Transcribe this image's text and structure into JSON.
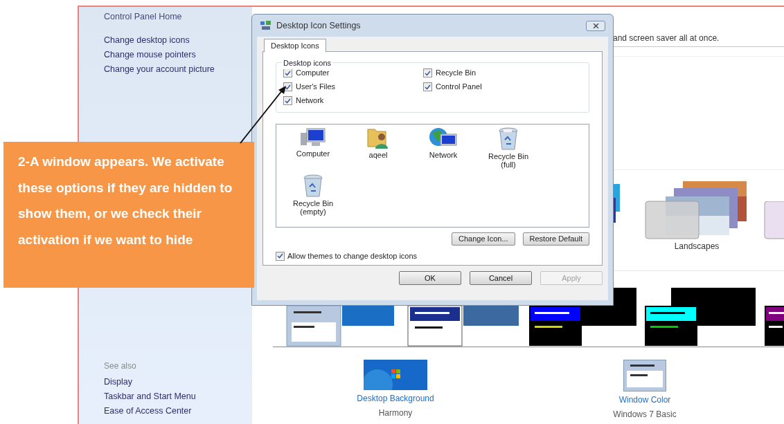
{
  "sidebar": {
    "home_link": "Control Panel Home",
    "tasks": [
      "Change desktop icons",
      "Change mouse pointers",
      "Change your account picture"
    ],
    "see_also_heading": "See also",
    "see_also": [
      "Display",
      "Taskbar and Start Menu",
      "Ease of Access Center"
    ]
  },
  "main": {
    "description": "and screen saver all at once.",
    "theme_label": "Landscapes",
    "bottom_items": [
      {
        "kind": "background",
        "label": "Desktop Background",
        "value": "Harmony"
      },
      {
        "kind": "window-color",
        "label": "Window Color",
        "value": "Windows 7 Basic"
      }
    ]
  },
  "dialog": {
    "title": "Desktop Icon Settings",
    "tabs": [
      {
        "label": "Desktop Icons",
        "selected": true
      }
    ],
    "group_label": "Desktop icons",
    "checkboxes": [
      {
        "label": "Computer",
        "checked": true
      },
      {
        "label": "User's Files",
        "checked": true
      },
      {
        "label": "Network",
        "checked": true
      },
      {
        "label": "Recycle Bin",
        "checked": true
      },
      {
        "label": "Control Panel",
        "checked": true
      }
    ],
    "icons": [
      {
        "kind": "computer",
        "label": "Computer"
      },
      {
        "kind": "user-folder",
        "label": "aqeel"
      },
      {
        "kind": "network",
        "label": "Network"
      },
      {
        "kind": "bin-full",
        "label": "Recycle Bin\n(full)"
      },
      {
        "kind": "bin-empty",
        "label": "Recycle Bin\n(empty)"
      }
    ],
    "icon_buttons": [
      "Change Icon...",
      "Restore Default"
    ],
    "allow_themes": {
      "label": "Allow themes to change desktop icons",
      "checked": true
    },
    "footer_buttons": [
      {
        "label": "OK",
        "disabled": false
      },
      {
        "label": "Cancel",
        "disabled": false
      },
      {
        "label": "Apply",
        "disabled": true
      }
    ]
  },
  "callout": {
    "text": "2-A window appears. We activate these options if they are hidden to show them, or we check their activation if we want to hide"
  }
}
